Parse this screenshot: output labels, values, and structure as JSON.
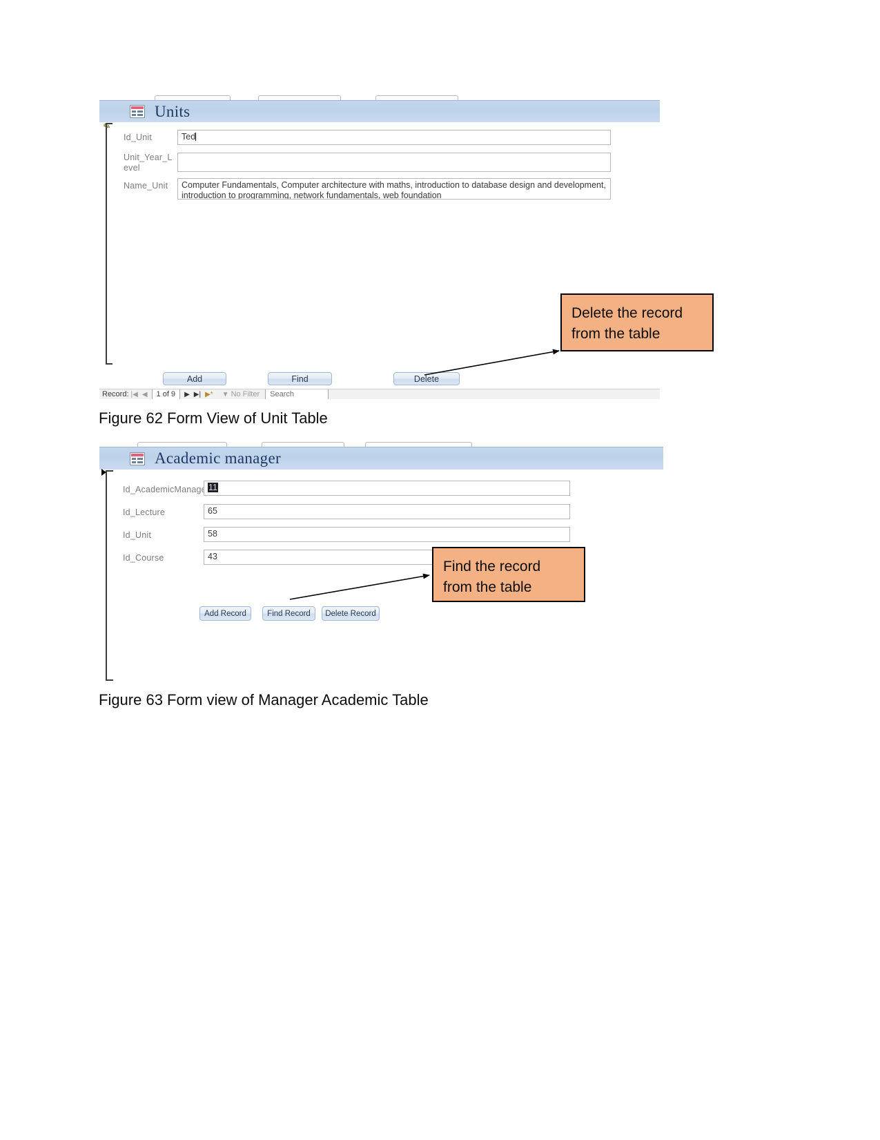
{
  "document": {
    "background": "#ffffff",
    "callout_fill": "#f4b183",
    "callout_border": "#000000",
    "form_header_title_color": "#1f3864"
  },
  "figure_unit": {
    "form": {
      "title": "Units",
      "header_icon": "form-table-icon",
      "fields": [
        {
          "label": "Id_Unit",
          "value": "Ted",
          "has_caret": true
        },
        {
          "label": "Unit_Year_Level",
          "value": "",
          "has_caret": true
        },
        {
          "label": "Name_Unit",
          "value": "Computer Fundamentals, Computer architecture with maths, introduction to database design and development, introduction to programming, network fundamentals, web foundation",
          "has_caret": false
        }
      ],
      "buttons": [
        {
          "label": "Add",
          "name": "add-button"
        },
        {
          "label": "Find",
          "name": "find-button"
        },
        {
          "label": "Delete",
          "name": "delete-button"
        }
      ],
      "navigator": {
        "record_label": "Record:",
        "first_glyph": "|◀",
        "prev_glyph": "◀",
        "position": "1 of 9",
        "next_glyph": "▶",
        "last_glyph": "▶|",
        "new_glyph": "▶*",
        "filter_glyph": "▼",
        "filter_label": "No Filter",
        "search_placeholder": "Search"
      }
    },
    "callout": {
      "line1": "Delete the record",
      "line2": "from the table"
    },
    "caption": "Figure 62 Form View of Unit Table"
  },
  "figure_manager": {
    "form": {
      "title": "Academic manager",
      "header_icon": "form-table-icon",
      "fields": [
        {
          "label": "Id_AcademicManager",
          "value": "11",
          "selected": true
        },
        {
          "label": "Id_Lecture",
          "value": "65",
          "selected": false
        },
        {
          "label": "Id_Unit",
          "value": "58",
          "selected": false
        },
        {
          "label": "Id_Course",
          "value": "43",
          "selected": false
        }
      ],
      "buttons": [
        {
          "label": "Add Record",
          "name": "add-record-button"
        },
        {
          "label": "Find Record",
          "name": "find-record-button"
        },
        {
          "label": "Delete Record",
          "name": "delete-record-button"
        }
      ]
    },
    "callout": {
      "line1": "Find the record",
      "line2": "from the table"
    },
    "caption": "Figure 63 Form view of Manager Academic Table"
  }
}
